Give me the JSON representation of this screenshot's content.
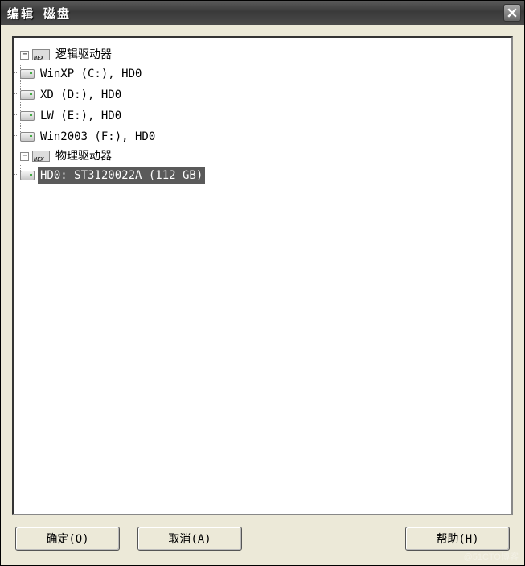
{
  "window": {
    "title": "编辑 磁盘"
  },
  "tree": {
    "logical": {
      "label": "逻辑驱动器",
      "items": [
        {
          "label": "WinXP (C:), HD0"
        },
        {
          "label": "XD (D:), HD0"
        },
        {
          "label": "LW (E:), HD0"
        },
        {
          "label": "Win2003 (F:), HD0"
        }
      ]
    },
    "physical": {
      "label": "物理驱动器",
      "items": [
        {
          "label": "HD0: ST3120022A (112 GB)",
          "selected": true
        }
      ]
    }
  },
  "buttons": {
    "ok": "确定(O)",
    "cancel": "取消(A)",
    "help": "帮助(H)"
  },
  "watermark": "@51CTO博客"
}
